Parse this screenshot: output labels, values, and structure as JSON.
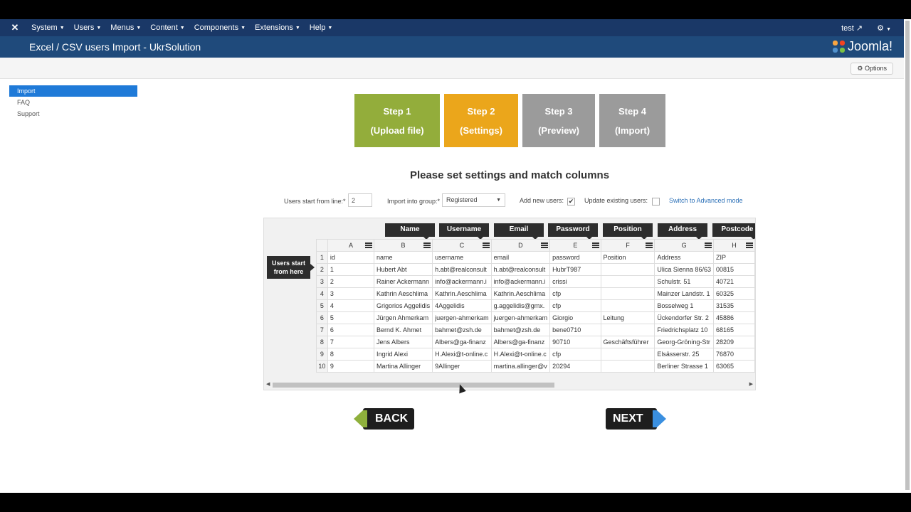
{
  "nav": {
    "menu": [
      "System",
      "Users",
      "Menus",
      "Content",
      "Components",
      "Extensions",
      "Help"
    ],
    "user": "test"
  },
  "header": {
    "title": "Excel / CSV users Import - UkrSolution",
    "brand": "Joomla!"
  },
  "toolbar": {
    "options_label": "Options"
  },
  "sidebar": {
    "items": [
      "Import",
      "FAQ",
      "Support"
    ]
  },
  "steps": [
    {
      "title": "Step 1",
      "sub": "(Upload file)"
    },
    {
      "title": "Step 2",
      "sub": "(Settings)"
    },
    {
      "title": "Step 3",
      "sub": "(Preview)"
    },
    {
      "title": "Step 4",
      "sub": "(Import)"
    }
  ],
  "heading": "Please set settings and match columns",
  "settings": {
    "start_line_label": "Users start from line:*",
    "start_line_value": "2",
    "group_label": "Import into group:*",
    "group_value": "Registered",
    "add_new_label": "Add new users:",
    "update_label": "Update existing users:",
    "advanced_link": "Switch to Advanced mode"
  },
  "grid": {
    "mapping": [
      "Name",
      "Username",
      "Email",
      "Password",
      "Position",
      "Address",
      "Postcode"
    ],
    "columns": [
      "A",
      "B",
      "C",
      "D",
      "E",
      "F",
      "G",
      "H"
    ],
    "rows": [
      [
        "1",
        "id",
        "name",
        "username",
        "email",
        "password",
        "Position",
        "Address",
        "ZIP"
      ],
      [
        "2",
        "1",
        "Hubert Abt",
        "h.abt@realconsult",
        "h.abt@realconsult",
        "HubrT987",
        "",
        "Ulica Sienna 86/63",
        "00815"
      ],
      [
        "3",
        "2",
        "Rainer Ackermann",
        "info@ackermann.i",
        "info@ackermann.i",
        "crissi",
        "",
        "Schulstr. 51",
        "40721"
      ],
      [
        "4",
        "3",
        "Kathrin Aeschlima",
        "Kathrin.Aeschlima",
        "Kathrin.Aeschlima",
        "cfp",
        "",
        "Mainzer Landstr. 1",
        "60325"
      ],
      [
        "5",
        "4",
        "Grigorios Aggelidis",
        "4Aggelidis",
        "g.aggelidis@gmx.",
        "cfp",
        "",
        "Bosselweg 1",
        "31535"
      ],
      [
        "6",
        "5",
        "Jürgen Ahmerkam",
        "juergen-ahmerkam",
        "juergen-ahmerkam",
        "Giorgio",
        "Leitung",
        "Ückendorfer Str. 2",
        "45886"
      ],
      [
        "7",
        "6",
        "Bernd K. Ahmet",
        "bahmet@zsh.de",
        "bahmet@zsh.de",
        "bene0710",
        "",
        "Friedrichsplatz 10",
        "68165"
      ],
      [
        "8",
        "7",
        "Jens Albers",
        "Albers@ga-finanz",
        "Albers@ga-finanz",
        "90710",
        "Geschäftsführer",
        "Georg-Gröning-Str",
        "28209"
      ],
      [
        "9",
        "8",
        "Ingrid Alexi",
        "H.Alexi@t-online.c",
        "H.Alexi@t-online.c",
        "cfp",
        "",
        "Elsässerstr. 25",
        "76870"
      ],
      [
        "10",
        "9",
        "Martina Allinger",
        "9Allinger",
        "martina.allinger@v",
        "20294",
        "",
        "Berliner Strasse 1",
        "63065"
      ]
    ],
    "start_badge": [
      "Users start",
      "from here"
    ]
  },
  "buttons": {
    "back": "BACK",
    "next": "NEXT"
  }
}
